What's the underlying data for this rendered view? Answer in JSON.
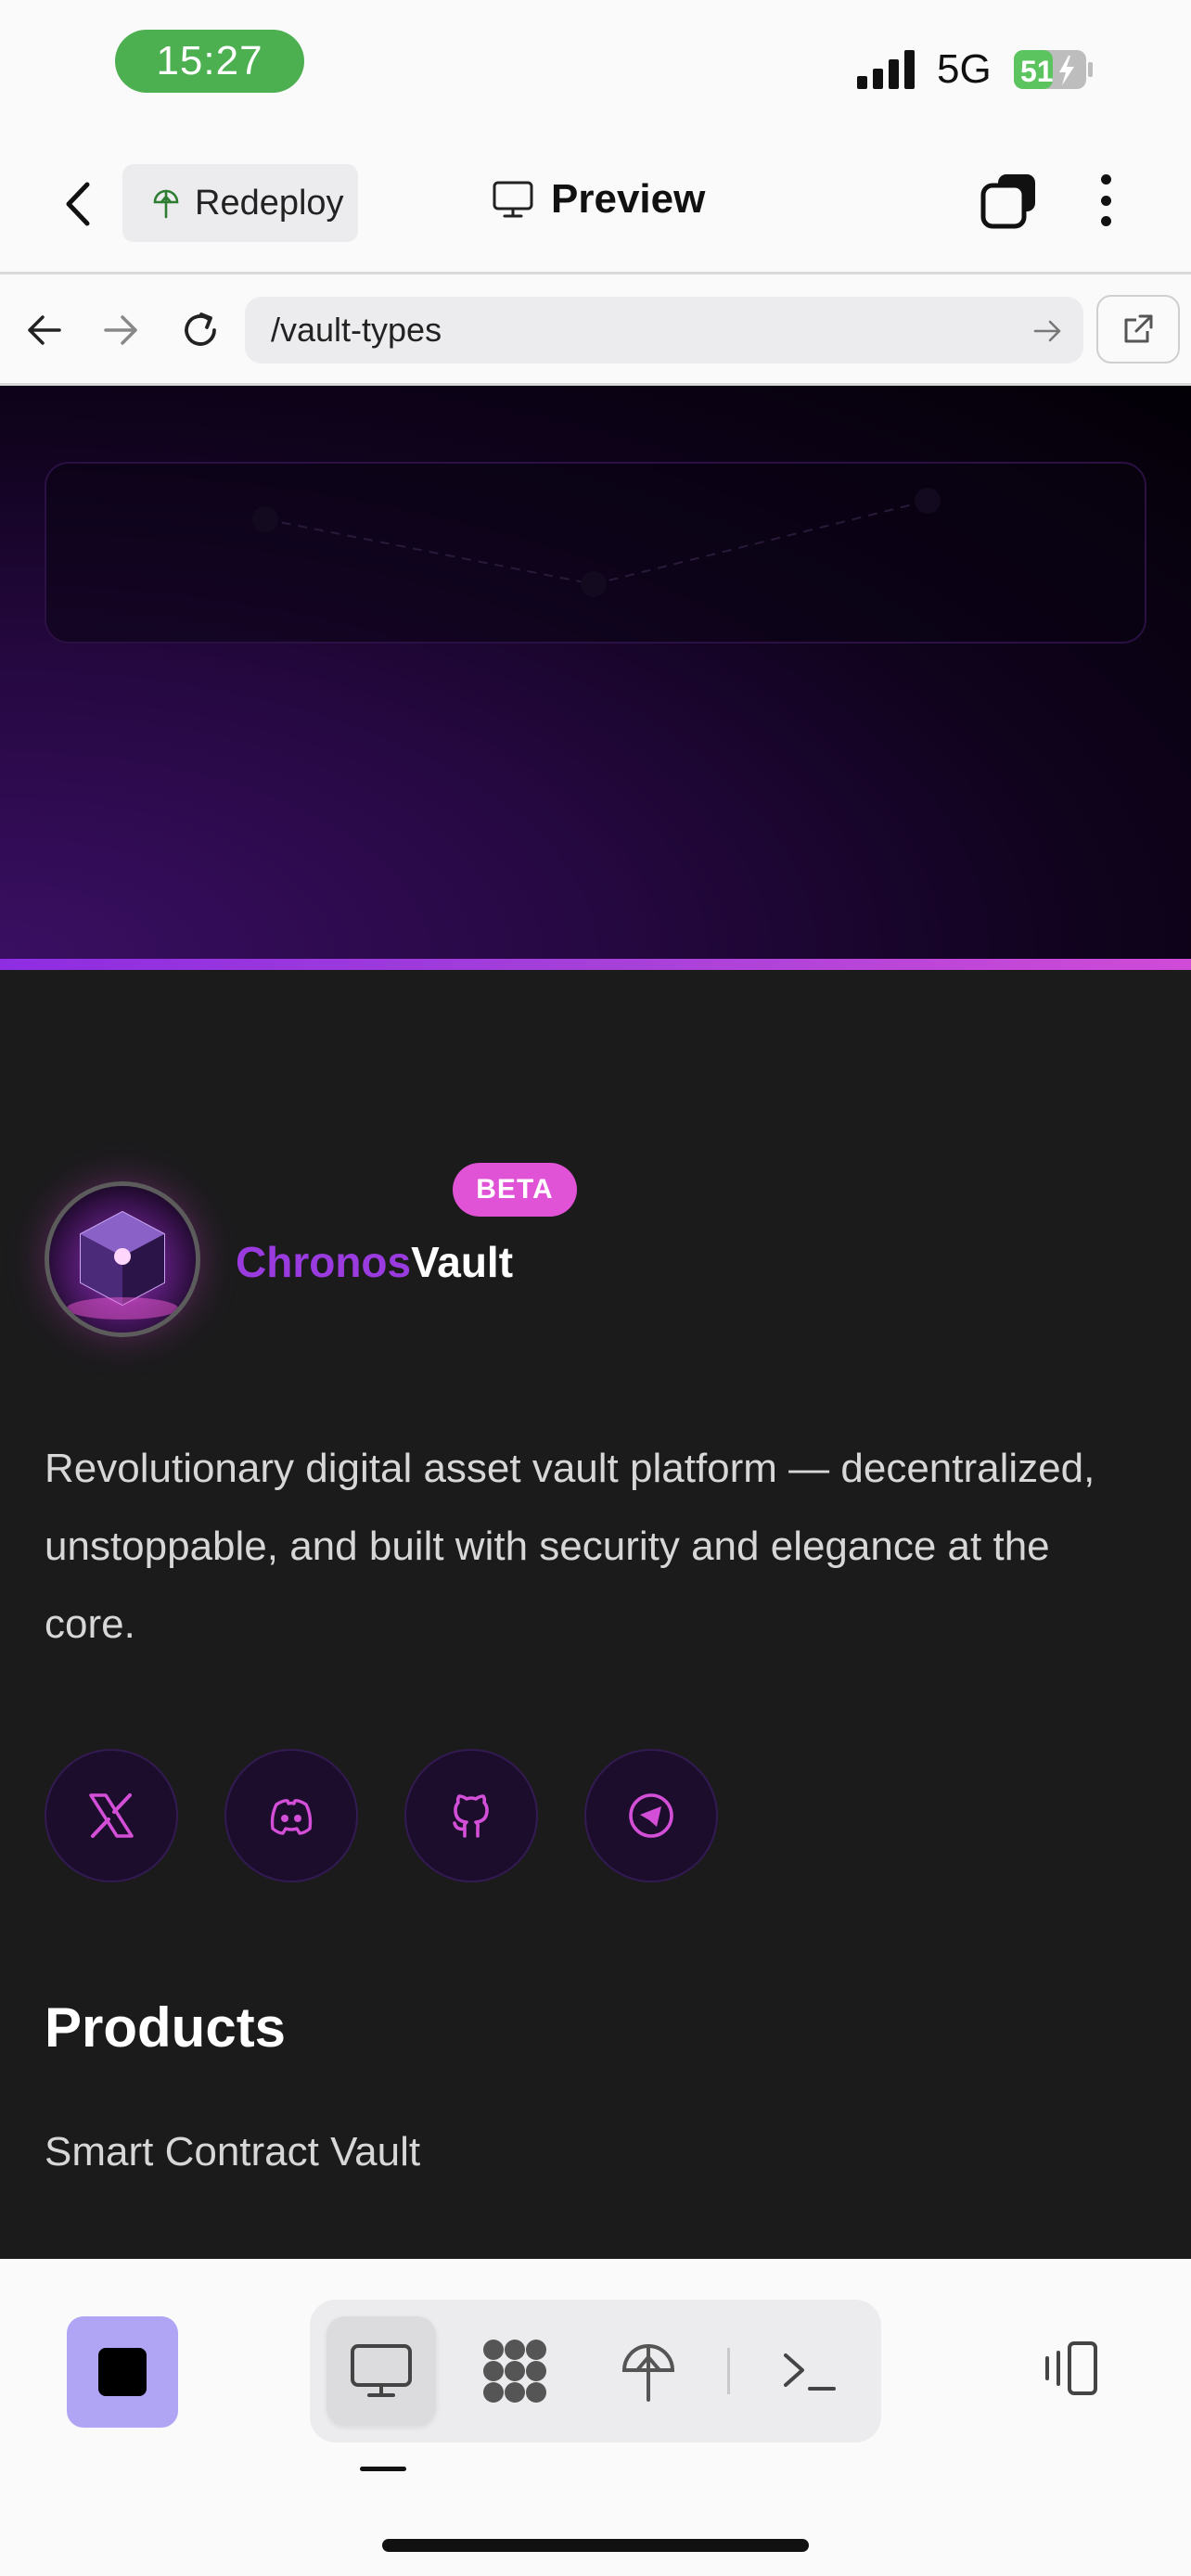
{
  "status_bar": {
    "time": "15:27",
    "network": "5G",
    "battery": "51"
  },
  "header": {
    "redeploy_label": "Redeploy",
    "title": "Preview"
  },
  "browser": {
    "url": "/vault-types"
  },
  "site": {
    "beta_badge": "BETA",
    "brand_part1": "Chronos",
    "brand_part2": "Vault",
    "tagline": "Revolutionary digital asset vault platform — decentralized, unstoppable, and built with security and elegance at the core.",
    "socials": [
      "x-icon",
      "discord-icon",
      "github-icon",
      "telegram-icon"
    ],
    "products_title": "Products",
    "products": [
      "Smart Contract Vault"
    ]
  },
  "colors": {
    "accent_purple": "#9a3be0",
    "accent_pink": "#e052d6",
    "status_green": "#4caf50",
    "stop_button": "#b0a4f5",
    "page_bg": "#1b1b1c"
  }
}
